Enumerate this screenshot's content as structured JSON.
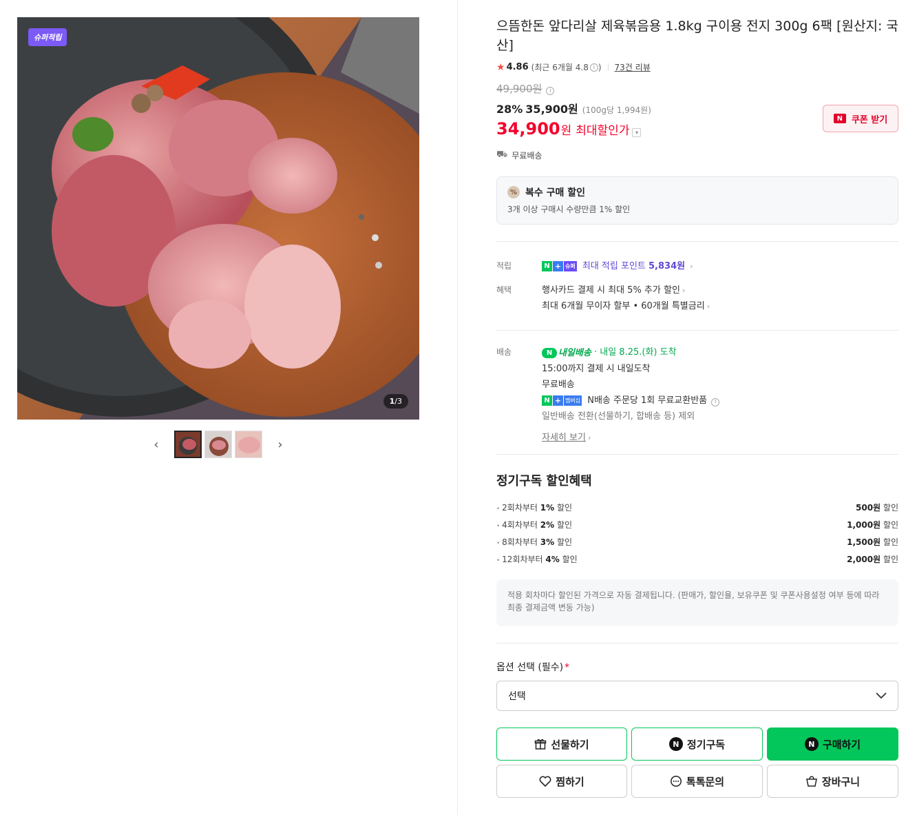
{
  "gallery": {
    "badge": "슈퍼적립",
    "counter_current": "1",
    "counter_total": "/3",
    "prev_icon": "chevron-left-icon",
    "next_icon": "chevron-right-icon",
    "thumbnail_count": 3
  },
  "product": {
    "title": "으뜸한돈 앞다리살 제육볶음용 1.8kg 구이용 전지 300g 6팩 [원산지: 국산]",
    "rating": "4.86",
    "rating_recent": "(최근 6개월 4.8",
    "rating_recent_close": ")",
    "review_link": "73건 리뷰"
  },
  "price": {
    "original": "49,900원",
    "discount_rate": "28%",
    "discount_price": "35,900원",
    "unit_price": "(100g당 1,994원)",
    "max_price": "34,900",
    "max_won": "원",
    "max_label": "최대할인가",
    "coupon_button": "쿠폰 받기",
    "coupon_n": "N",
    "colors": {
      "sale": "#f4002c",
      "naver_green": "#03c75a"
    }
  },
  "shipping_line": "무료배송",
  "multi_discount": {
    "title": "복수 구매 할인",
    "desc": "3개 이상 구매시 수량만큼 1% 할인",
    "icon": "%"
  },
  "benefits": {
    "point_label": "적립",
    "point_super": "슈퍼",
    "point_text": "최대 적립 포인트",
    "point_value": "5,834원",
    "benefit_label": "혜택",
    "benefit_line1": "행사카드 결제 시 최대 5% 추가 할인",
    "benefit_line2": "최대 6개월 무이자 할부 • 60개월 특별금리"
  },
  "delivery": {
    "label": "배송",
    "badge": "내일배송",
    "arrival": "· 내일 8.25.(화) 도착",
    "cutoff": "15:00까지 결제 시 내일도착",
    "free": "무료배송",
    "member_badge": "멤버십",
    "exchange": "N배송 주문당 1회 무료교환반품",
    "exclude": "일반배송 전환(선물하기, 합배송 등) 제외",
    "detail_link": "자세히 보기"
  },
  "subscription": {
    "title": "정기구독 할인혜택",
    "items": [
      {
        "left_pre": "2회차부터 ",
        "left_bold": "1%",
        "left_post": " 할인",
        "right_bold": "500원",
        "right_post": " 할인"
      },
      {
        "left_pre": "4회차부터 ",
        "left_bold": "2%",
        "left_post": " 할인",
        "right_bold": "1,000원",
        "right_post": " 할인"
      },
      {
        "left_pre": "8회차부터 ",
        "left_bold": "3%",
        "left_post": " 할인",
        "right_bold": "1,500원",
        "right_post": " 할인"
      },
      {
        "left_pre": "12회차부터 ",
        "left_bold": "4%",
        "left_post": " 할인",
        "right_bold": "2,000원",
        "right_post": " 할인"
      }
    ],
    "note": "적용 회차마다 할인된 가격으로 자동 결제됩니다. (판매가, 할인율, 보유쿠폰 및 쿠폰사용설정 여부 등에 따라 최종 결제금액 변동 가능)"
  },
  "option": {
    "label": "옵션 선택 (필수)",
    "required_mark": "*",
    "selected": "선택"
  },
  "buttons": {
    "gift": "선물하기",
    "subscribe": "정기구독",
    "buy": "구매하기",
    "wish": "찜하기",
    "talk": "톡톡문의",
    "cart": "장바구니",
    "n_letter": "N"
  }
}
